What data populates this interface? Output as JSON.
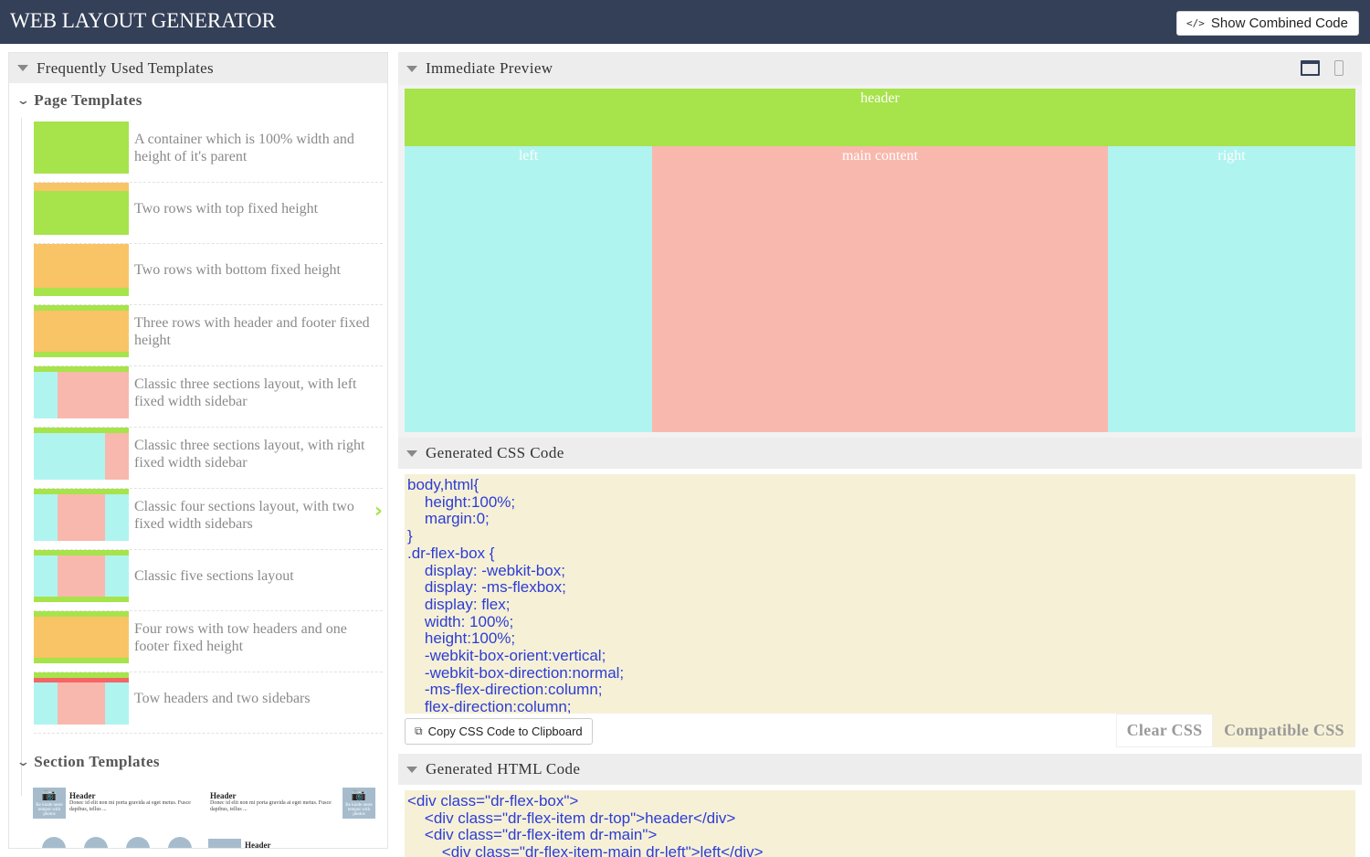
{
  "app": {
    "title": "WEB LAYOUT GENERATOR",
    "show_combined": "Show Combined Code",
    "code_icon": "</>"
  },
  "left": {
    "heading": "Frequently Used Templates",
    "page_templates": "Page Templates",
    "section_templates": "Section Templates",
    "items": [
      {
        "label": "A container which is 100% width and height of it's parent"
      },
      {
        "label": "Two rows with top fixed height"
      },
      {
        "label": "Two rows with bottom fixed height"
      },
      {
        "label": "Three rows with header and footer fixed height"
      },
      {
        "label": "Classic three sections layout, with left fixed width sidebar"
      },
      {
        "label": "Classic three sections layout, with right fixed width sidebar"
      },
      {
        "label": "Classic four sections layout, with two fixed width sidebars"
      },
      {
        "label": "Classic five sections layout"
      },
      {
        "label": "Four rows with tow headers and one footer fixed height"
      },
      {
        "label": "Tow headers and two sidebars"
      }
    ],
    "section_samples": [
      {
        "heading": "Header",
        "body": "Donec id elit non mi porta gravida at eget metus. Fusce dapibus, tellus ..."
      },
      {
        "heading": "Header",
        "body": "Donec id elit non mi porta gravida at eget metus. Fusce dapibus, tellus ..."
      }
    ],
    "photo_caption": "Be kinde neste tempor with photos",
    "next_heading": "Header"
  },
  "preview": {
    "heading": "Immediate Preview",
    "header": "header",
    "left": "left",
    "main": "main content",
    "right": "right",
    "icons": [
      "desktop-view-icon",
      "mobile-view-icon"
    ]
  },
  "css": {
    "heading": "Generated CSS Code",
    "lines": [
      "body,html{",
      "\theight:100%;",
      "\tmargin:0;",
      "}",
      ".dr-flex-box {",
      "\tdisplay: -webkit-box;",
      "\tdisplay: -ms-flexbox;",
      "\tdisplay: flex;",
      "\twidth: 100%;",
      "\theight:100%;",
      "\t-webkit-box-orient:vertical;",
      "\t-webkit-box-direction:normal;",
      "\t-ms-flex-direction:column;",
      "\tflex-direction:column;"
    ],
    "copy_label": "Copy CSS Code to Clipboard",
    "clear_label": "Clear CSS",
    "compatible_label": "Compatible CSS"
  },
  "html_code": {
    "heading": "Generated HTML Code",
    "lines": [
      "<div class=\"dr-flex-box\">",
      "\t<div class=\"dr-flex-item dr-top\">header</div>",
      "\t<div class=\"dr-flex-item dr-main\">",
      "\t\t<div class=\"dr-flex-item-main dr-left\">left</div>"
    ]
  }
}
